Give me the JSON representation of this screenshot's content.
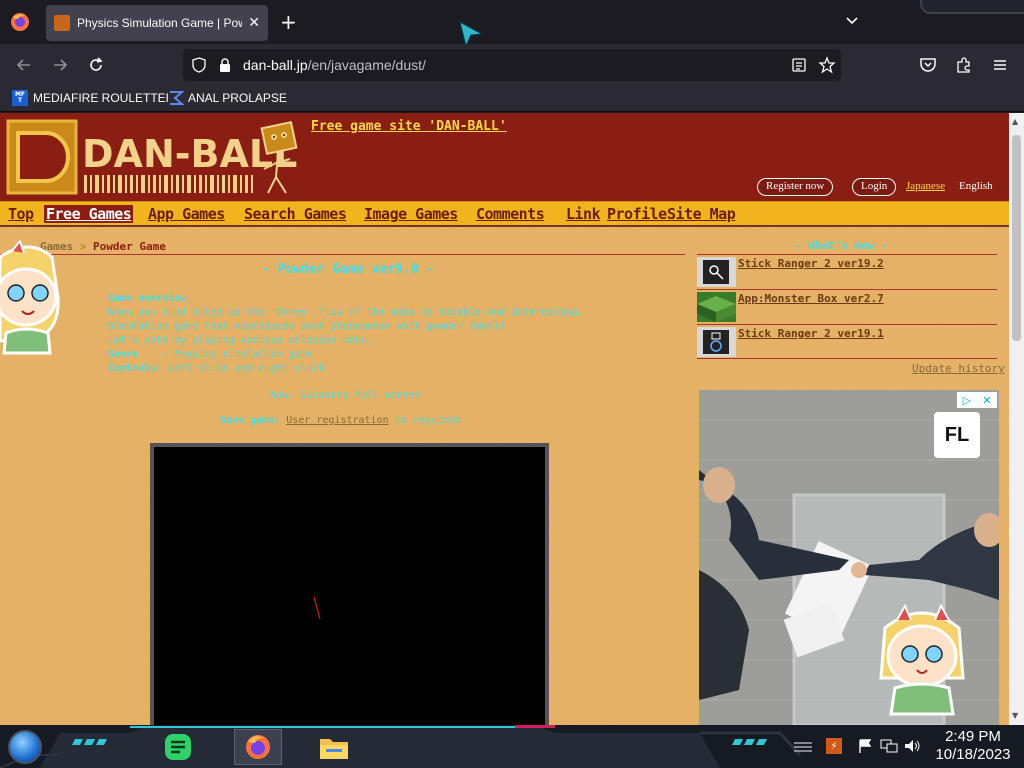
{
  "browser": {
    "tab_title": "Physics Simulation Game | Pow",
    "tab_close": "✕",
    "new_tab": "+",
    "url_domain": "dan-ball.jp",
    "url_path": "/en/javagame/dust/",
    "bookmarks": [
      {
        "label": "MEDIAFIRE ROULETTER",
        "icon": "mediafire-icon",
        "icon_text": "MF T"
      },
      {
        "label": "ANAL PROLAPSE",
        "icon": "sigma-icon"
      }
    ]
  },
  "site": {
    "logo_text": "DAN-BALL",
    "tagline": "Free game site 'DAN-BALL'",
    "register_label": "Register now",
    "login_label": "Login",
    "lang_japanese": "Japanese",
    "lang_english": "English",
    "menu": [
      "Top",
      "Free Games",
      "App Games",
      "Search Games",
      "Image Games",
      "Comments",
      "Link",
      "Profile",
      "Site Map"
    ],
    "active_menu": "Free Games"
  },
  "breadcrumb": {
    "parent": "Games",
    "separator": ">",
    "current": "Powder Game"
  },
  "game": {
    "title": "- Powder Game ver9.0 -",
    "overview_heading": "Game overview",
    "overview_lines": [
      "When you'rind piled up the 'Games' flow of the wind is visible and interesting.",
      "Simulation game that reproduces such phenomenon with powder (dot)!",
      "Let's vote by playing various unleaded menu."
    ],
    "genre_label": "Genre",
    "genre_value": ": Physics simulation game",
    "controls_label": "Controls",
    "controls_value": ": Left click and right click",
    "note": "Now: Supports full screen",
    "save_label": "Save game:",
    "save_link": "User registration",
    "save_suffix": "is required."
  },
  "sidebar": {
    "whats_new_title": "- What's new -",
    "news": [
      {
        "title": "Stick Ranger 2 ver19.2",
        "icon": "stick-ranger-icon"
      },
      {
        "title": "App:Monster Box ver2.7",
        "icon": "monster-box-icon"
      },
      {
        "title": "Stick Ranger 2 ver19.1",
        "icon": "stick-ranger-icon"
      }
    ],
    "update_history": "Update history",
    "ad_logo": "FL"
  },
  "taskbar": {
    "time": "2:49 PM",
    "date": "10/18/2023"
  },
  "colors": {
    "header_red": "#8a1e12",
    "menu_yellow": "#f2b41d",
    "page_bg": "#e8b365",
    "cyan_text": "#3fe0e6"
  }
}
